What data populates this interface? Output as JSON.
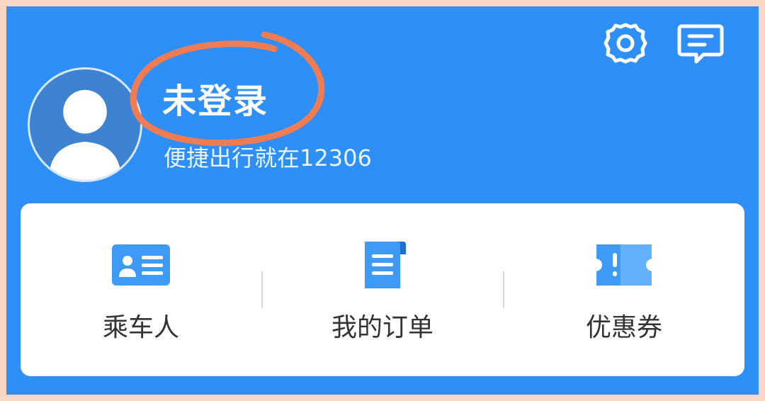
{
  "header": {
    "title": "未登录",
    "subtitle": "便捷出行就在12306",
    "icons": [
      "gear-icon",
      "message-icon"
    ],
    "avatar_icon": "user-avatar-icon"
  },
  "quick_entries": [
    {
      "label": "乘车人",
      "icon": "passenger-card-icon"
    },
    {
      "label": "我的订单",
      "icon": "order-document-icon"
    },
    {
      "label": "优惠券",
      "icon": "coupon-ticket-icon"
    }
  ],
  "colors": {
    "header_bg": "#2e8ff6",
    "card_bg": "#ffffff",
    "annotation": "#f07c54",
    "outer_border": "#fbd6c4"
  }
}
